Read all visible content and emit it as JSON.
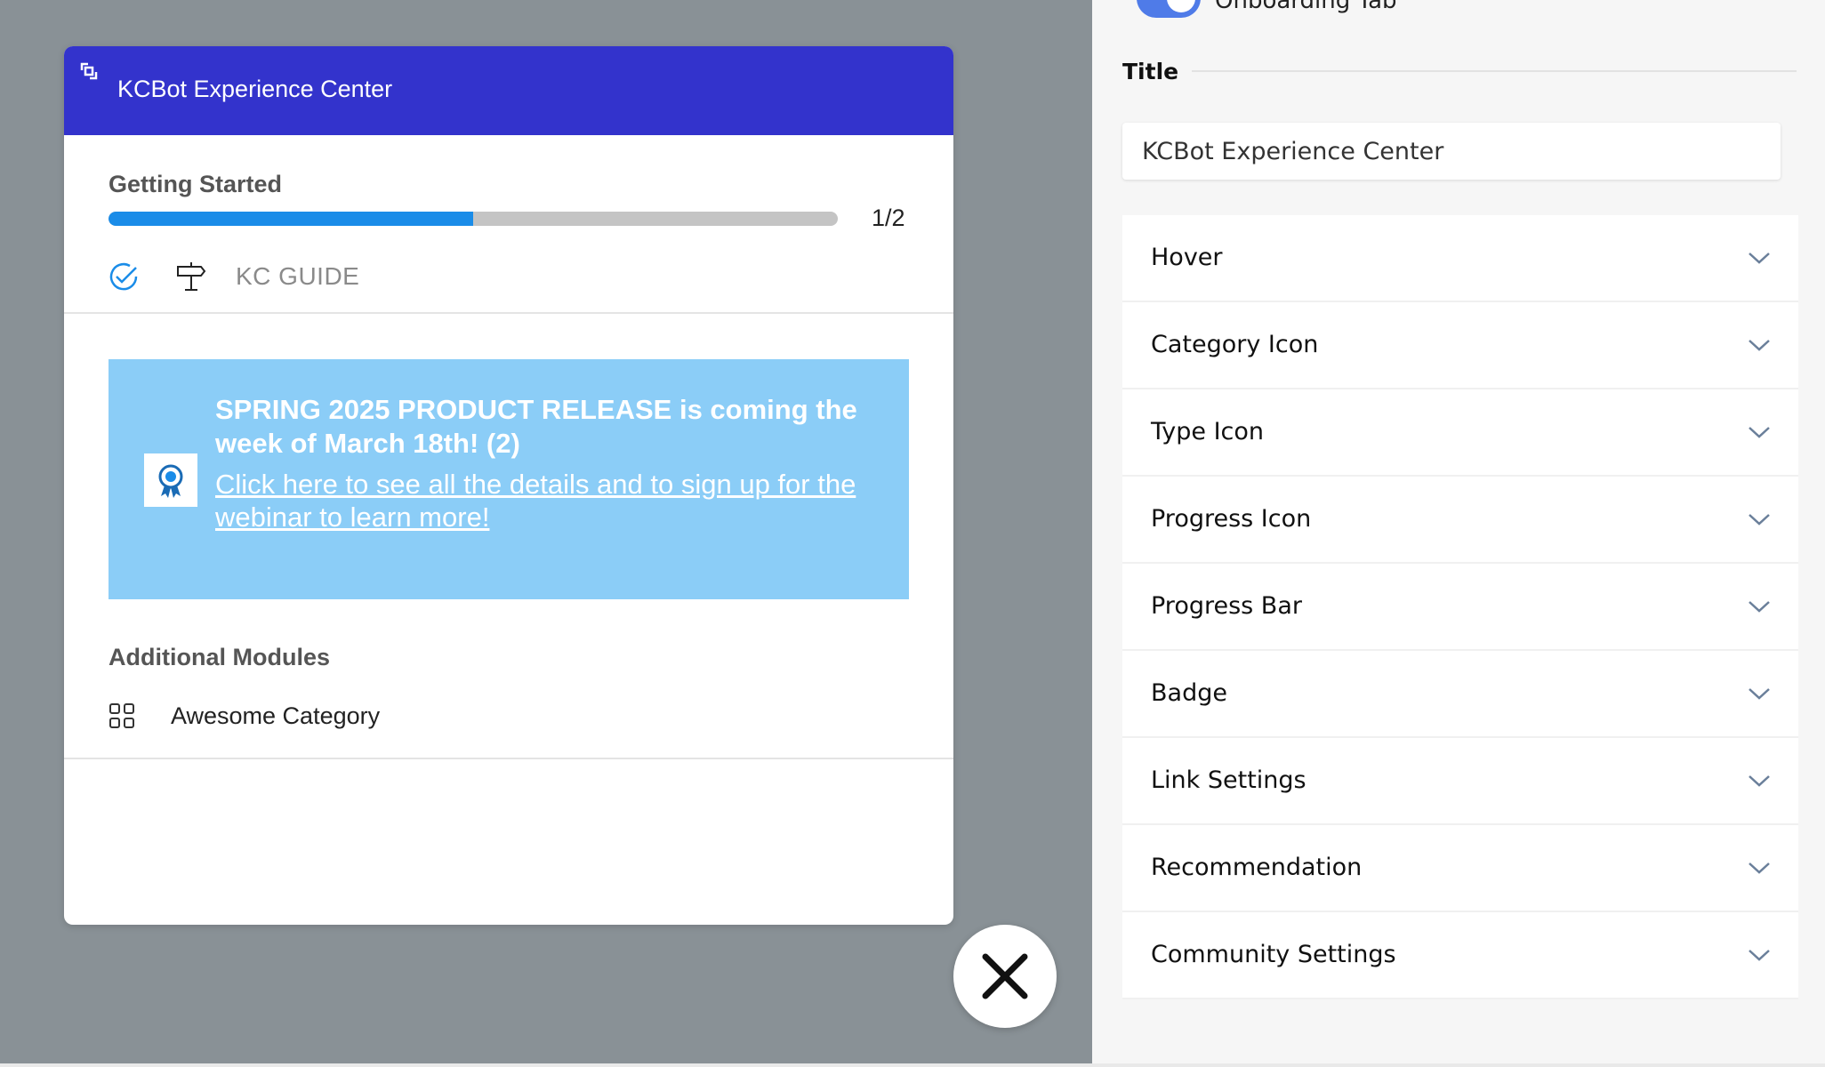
{
  "widget": {
    "title": "KCBot Experience Center",
    "getting_started": {
      "label": "Getting Started",
      "progress": 0.5,
      "count": "1/2",
      "guide_label": "KC GUIDE"
    },
    "banner": {
      "heading": "SPRING 2025 PRODUCT RELEASE is coming the week of March 18th! (2)",
      "link": " Click here to see all the details and to sign up for the webinar to learn more! ",
      "color": "#8bcdf7"
    },
    "additional_modules": {
      "label": "Additional Modules",
      "items": [
        {
          "label": "Awesome Category"
        }
      ]
    },
    "header_color": "#3333cc",
    "progress_color": "#1a8ce8"
  },
  "panel": {
    "toggle_label": "Onboarding Tab",
    "toggle_on": true,
    "title_label": "Title",
    "title_value": "KCBot Experience Center",
    "sections": [
      {
        "label": "Hover"
      },
      {
        "label": "Category Icon"
      },
      {
        "label": "Type Icon"
      },
      {
        "label": "Progress Icon"
      },
      {
        "label": "Progress Bar"
      },
      {
        "label": "Badge"
      },
      {
        "label": "Link Settings"
      },
      {
        "label": "Recommendation"
      },
      {
        "label": "Community Settings"
      }
    ],
    "accent_color": "#4f7be8"
  }
}
